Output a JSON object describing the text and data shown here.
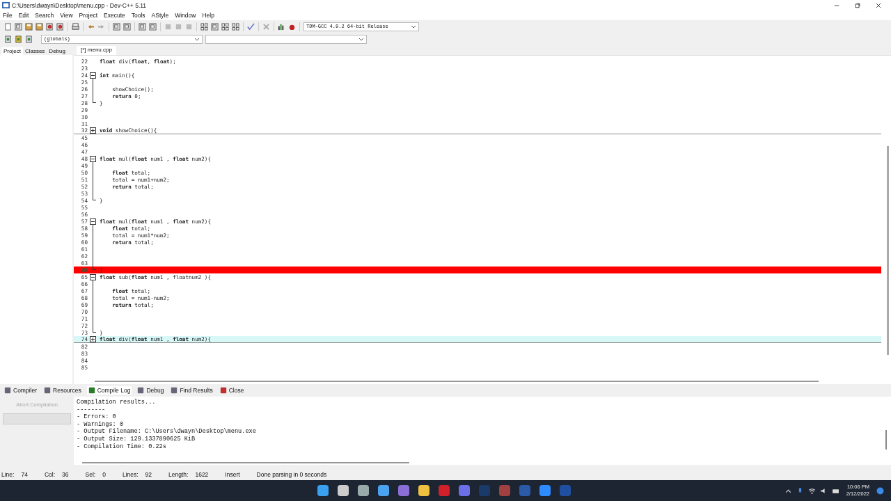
{
  "window": {
    "title": "C:\\Users\\dwayn\\Desktop\\menu.cpp - Dev-C++ 5.11"
  },
  "menu": [
    "File",
    "Edit",
    "Search",
    "View",
    "Project",
    "Execute",
    "Tools",
    "AStyle",
    "Window",
    "Help"
  ],
  "compiler_select": {
    "value": "TDM-GCC 4.9.2 64-bit Release"
  },
  "scope_select": {
    "value": "(globals)"
  },
  "side_tabs": [
    {
      "label": "Project",
      "selected": true
    },
    {
      "label": "Classes",
      "selected": false
    },
    {
      "label": "Debug",
      "selected": false
    }
  ],
  "editor_tabs": [
    {
      "label": "[*] menu.cpp",
      "selected": true
    }
  ],
  "lines": [
    {
      "number": "22",
      "code": "**float** div(**float**, **float**);",
      "kind": "plain",
      "collapsed": false,
      "error": false,
      "current": false
    },
    {
      "number": "23",
      "kind": "plain",
      "collapsed": false,
      "error": false,
      "current": false
    },
    {
      "number": "24",
      "code": "**int** main(){",
      "kind": "open",
      "collapsed": false,
      "error": false,
      "current": false
    },
    {
      "number": "25",
      "kind": "bar",
      "collapsed": false,
      "error": false,
      "current": false
    },
    {
      "number": "26",
      "code": "    showChoice();",
      "kind": "bar",
      "collapsed": false,
      "error": false,
      "current": false
    },
    {
      "number": "27",
      "code": "    **return** 0;",
      "kind": "bar",
      "collapsed": false,
      "error": false,
      "current": false
    },
    {
      "number": "28",
      "code": "}",
      "kind": "end",
      "collapsed": false,
      "error": false,
      "current": false
    },
    {
      "number": "29",
      "kind": "plain",
      "collapsed": false,
      "error": false,
      "current": false
    },
    {
      "number": "30",
      "kind": "plain",
      "collapsed": false,
      "error": false,
      "current": false
    },
    {
      "number": "31",
      "kind": "plain",
      "collapsed": false,
      "error": false,
      "current": false
    },
    {
      "number": "32",
      "code": "**void** showChoice(){",
      "kind": "closed",
      "collapsed": true,
      "error": false,
      "current": false
    },
    {
      "number": "45",
      "kind": "plain",
      "collapsed": false,
      "error": false,
      "current": false
    },
    {
      "number": "46",
      "kind": "plain",
      "collapsed": false,
      "error": false,
      "current": false
    },
    {
      "number": "47",
      "kind": "plain",
      "collapsed": false,
      "error": false,
      "current": false
    },
    {
      "number": "48",
      "code": "**float** mul(**float** num1 , **float** num2){",
      "kind": "open",
      "collapsed": false,
      "error": false,
      "current": false
    },
    {
      "number": "49",
      "kind": "bar",
      "collapsed": false,
      "error": false,
      "current": false
    },
    {
      "number": "50",
      "code": "    **float** total;",
      "kind": "bar",
      "collapsed": false,
      "error": false,
      "current": false
    },
    {
      "number": "51",
      "code": "    total = num1+num2;",
      "kind": "bar",
      "collapsed": false,
      "error": false,
      "current": false
    },
    {
      "number": "52",
      "code": "    **return** total;",
      "kind": "bar",
      "collapsed": false,
      "error": false,
      "current": false
    },
    {
      "number": "53",
      "kind": "bar",
      "collapsed": false,
      "error": false,
      "current": false
    },
    {
      "number": "54",
      "code": "}",
      "kind": "end",
      "collapsed": false,
      "error": false,
      "current": false
    },
    {
      "number": "55",
      "kind": "plain",
      "collapsed": false,
      "error": false,
      "current": false
    },
    {
      "number": "56",
      "kind": "plain",
      "collapsed": false,
      "error": false,
      "current": false
    },
    {
      "number": "57",
      "code": "**float** mul(**float** num1 , **float** num2){",
      "kind": "open",
      "collapsed": false,
      "error": false,
      "current": false
    },
    {
      "number": "58",
      "code": "    **float** total;",
      "kind": "bar",
      "collapsed": false,
      "error": false,
      "current": false
    },
    {
      "number": "59",
      "code": "    total = num1*num2;",
      "kind": "bar",
      "collapsed": false,
      "error": false,
      "current": false
    },
    {
      "number": "60",
      "code": "    **return** total;",
      "kind": "bar",
      "collapsed": false,
      "error": false,
      "current": false
    },
    {
      "number": "61",
      "kind": "bar",
      "collapsed": false,
      "error": false,
      "current": false
    },
    {
      "number": "62",
      "kind": "bar",
      "collapsed": false,
      "error": false,
      "current": false
    },
    {
      "number": "63",
      "kind": "bar",
      "collapsed": false,
      "error": false,
      "current": false
    },
    {
      "code": "}",
      "kind": "end",
      "collapsed": false,
      "error": true,
      "current": false
    },
    {
      "number": "65",
      "code": "**float** sub(**float** num1 , floatnum2 ){",
      "kind": "open",
      "collapsed": false,
      "error": false,
      "current": false
    },
    {
      "number": "66",
      "kind": "bar",
      "collapsed": false,
      "error": false,
      "current": false
    },
    {
      "number": "67",
      "code": "    **float** total;",
      "kind": "bar",
      "collapsed": false,
      "error": false,
      "current": false
    },
    {
      "number": "68",
      "code": "    total = num1-num2;",
      "kind": "bar",
      "collapsed": false,
      "error": false,
      "current": false
    },
    {
      "number": "69",
      "code": "    **return** total;",
      "kind": "bar",
      "collapsed": false,
      "error": false,
      "current": false
    },
    {
      "number": "70",
      "kind": "bar",
      "collapsed": false,
      "error": false,
      "current": false
    },
    {
      "number": "71",
      "kind": "bar",
      "collapsed": false,
      "error": false,
      "current": false
    },
    {
      "number": "72",
      "kind": "bar",
      "collapsed": false,
      "error": false,
      "current": false
    },
    {
      "number": "73",
      "code": "}",
      "kind": "end",
      "collapsed": false,
      "error": false,
      "current": false
    },
    {
      "number": "74",
      "code": "**float** div(**float** num1 , **float** num2){",
      "kind": "closed",
      "collapsed": true,
      "error": false,
      "current": true
    },
    {
      "number": "82",
      "kind": "plain",
      "collapsed": false,
      "error": false,
      "current": false
    },
    {
      "number": "83",
      "kind": "plain",
      "collapsed": false,
      "error": false,
      "current": false
    },
    {
      "number": "84",
      "kind": "plain",
      "collapsed": false,
      "error": false,
      "current": false
    },
    {
      "number": "85",
      "kind": "plain",
      "collapsed": false,
      "error": false,
      "current": false
    }
  ],
  "bottom_tabs": [
    {
      "label": "Compiler",
      "selected": false
    },
    {
      "label": "Resources",
      "selected": false
    },
    {
      "label": "Compile Log",
      "selected": true
    },
    {
      "label": "Debug",
      "selected": false
    },
    {
      "label": "Find Results",
      "selected": false
    },
    {
      "label": "Close",
      "selected": false
    }
  ],
  "abort_button": {
    "label": "Abort Compilation",
    "disabled": true
  },
  "compile_log": [
    "Compilation results...",
    "--------",
    "- Errors: 0",
    "- Warnings: 0",
    "- Output Filename: C:\\Users\\dwayn\\Desktop\\menu.exe",
    "- Output Size: 129.1337890625 KiB",
    "- Compilation Time: 0.22s"
  ],
  "status_bar": [
    {
      "label": "Line:",
      "value": "74"
    },
    {
      "label": "Col:",
      "value": "36"
    },
    {
      "label": "Sel:",
      "value": "0"
    },
    {
      "label": "Lines:",
      "value": "92"
    },
    {
      "label": "Length:",
      "value": "1622"
    },
    {
      "value": "Insert"
    },
    {
      "value": "Done parsing in 0 seconds"
    }
  ],
  "clock": {
    "time": "10:06 PM",
    "date": "2/12/2022"
  }
}
